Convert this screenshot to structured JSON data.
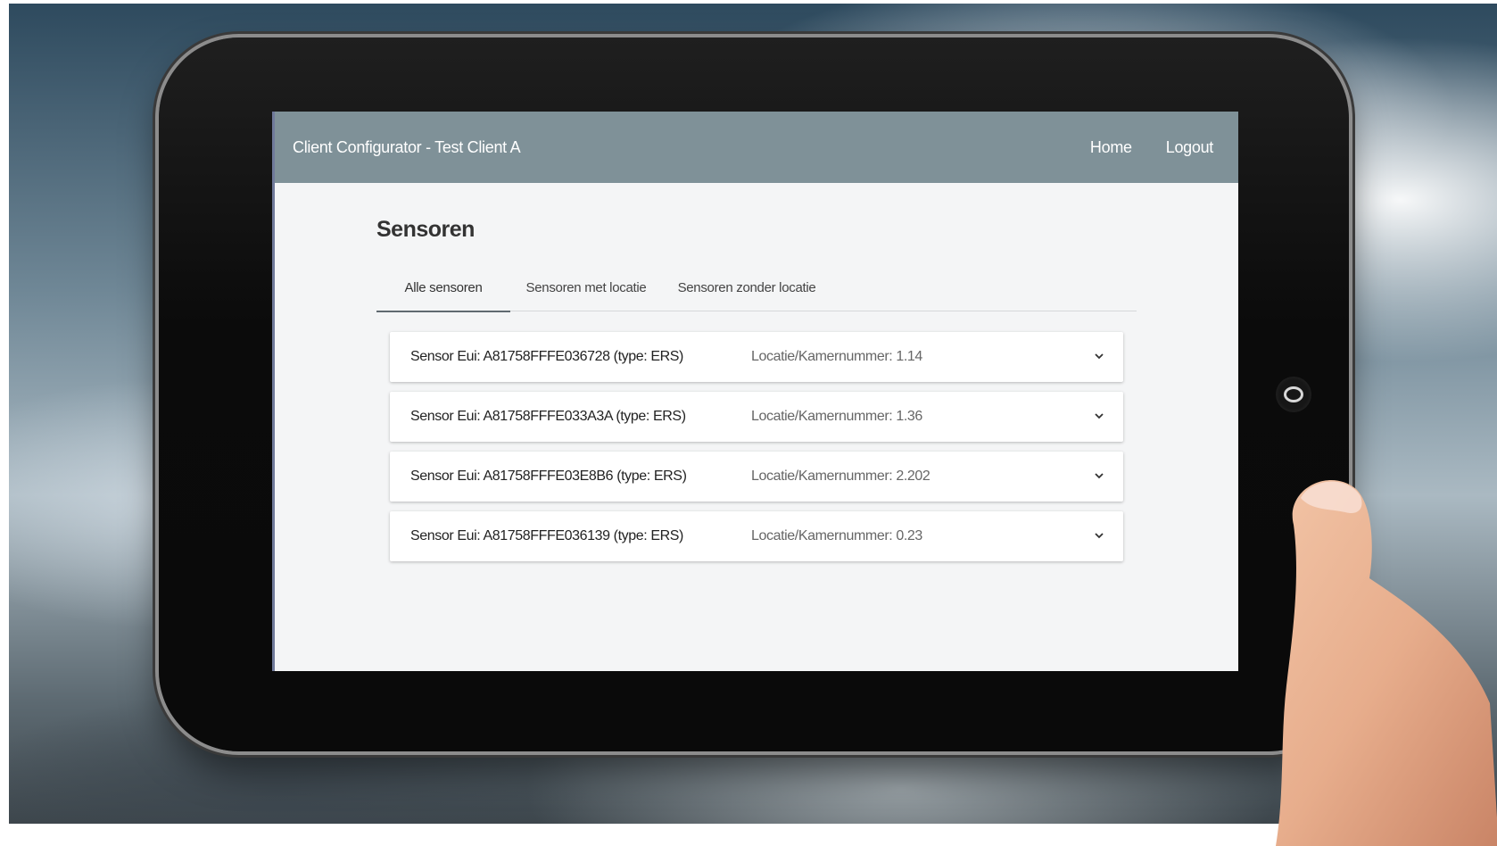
{
  "app": {
    "title": "Client Configurator - Test Client A"
  },
  "nav": {
    "home": "Home",
    "logout": "Logout"
  },
  "page": {
    "title": "Sensoren"
  },
  "tabs": [
    {
      "label": "Alle sensoren",
      "active": true
    },
    {
      "label": "Sensoren met locatie",
      "active": false
    },
    {
      "label": "Sensoren zonder locatie",
      "active": false
    }
  ],
  "sensors": [
    {
      "eui": "Sensor Eui: A81758FFFE036728 (type: ERS)",
      "location": "Locatie/Kamernummer: 1.14",
      "icon": "chevron-down-icon"
    },
    {
      "eui": "Sensor Eui: A81758FFFE033A3A (type: ERS)",
      "location": "Locatie/Kamernummer: 1.36",
      "icon": "chevron-down-icon"
    },
    {
      "eui": "Sensor Eui: A81758FFFE03E8B6 (type: ERS)",
      "location": "Locatie/Kamernummer: 2.202",
      "icon": "chevron-down-icon"
    },
    {
      "eui": "Sensor Eui: A81758FFFE036139 (type: ERS)",
      "location": "Locatie/Kamernummer: 0.23",
      "icon": "chevron-down-icon"
    }
  ],
  "colors": {
    "appbar": "#7f9198",
    "screen_bg": "#f4f5f6",
    "tab_indicator": "#606a70"
  }
}
